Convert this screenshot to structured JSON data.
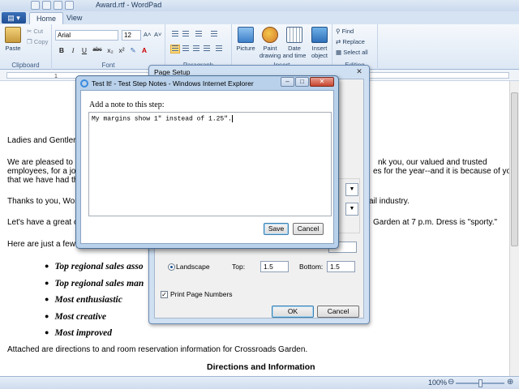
{
  "wordpad": {
    "title": "Award.rtf - WordPad",
    "app_button": "▤ ▾",
    "tabs": [
      "Home",
      "View"
    ],
    "ribbon": {
      "clipboard": {
        "label": "Clipboard",
        "paste": "Paste",
        "cut": "Cut",
        "copy": "Copy"
      },
      "font": {
        "label": "Font",
        "family": "Arial",
        "size": "12",
        "grow": "A˄",
        "shrink": "A˅",
        "bold": "B",
        "italic": "I",
        "underline": "U",
        "strike": "abc",
        "subscript": "x₂",
        "superscript": "x²"
      },
      "paragraph": {
        "label": "Paragraph"
      },
      "insert": {
        "label": "Insert",
        "picture": "Picture",
        "paint": "Paint drawing",
        "datetime": "Date and time",
        "object": "Insert object"
      },
      "editing": {
        "label": "Editing",
        "find": "Find",
        "replace": "Replace",
        "select_all": "Select all"
      }
    },
    "ruler": {
      "mark": "1"
    },
    "document": {
      "greeting": "Ladies and Gentler",
      "p1_l1_start": "We are pleased to",
      "p1_l1_end": "nk you, our valued and trusted",
      "p1_l2_start": "employees, for a job",
      "p1_l2_end": "es for the year--and it is because of you",
      "p1_l3": "that we have had thi",
      "p2_start": "Thanks to you, Worl",
      "p2_end": "ail industry.",
      "p3_start": "Let's have a great c",
      "p3_end": "Garden at 7 p.m. Dress is \"sporty.\"",
      "p4": "Here are just a few",
      "bullets": [
        "Top regional sales asso",
        "Top regional sales man",
        "Most enthusiastic",
        "Most creative",
        "Most improved"
      ],
      "attached": "Attached are directions to and room reservation information for Crossroads Garden.",
      "heading": "Directions and Information"
    },
    "status": {
      "zoom": "100%",
      "zoom_out": "⊖",
      "zoom_in": "⊕"
    }
  },
  "page_setup": {
    "title": "Page Setup",
    "close": "✕",
    "landscape": "Landscape",
    "top_label": "Top:",
    "top_value": "1.5",
    "bottom_label": "Bottom:",
    "bottom_value": "1.5",
    "print_page_numbers": "Print Page Numbers",
    "ok": "OK",
    "cancel": "Cancel"
  },
  "note_dialog": {
    "title": "Test It! - Test Step Notes - Windows Internet Explorer",
    "prompt": "Add a note to this step:",
    "note_text": "My margins show 1\" instead of 1.25\".",
    "save": "Save",
    "cancel": "Cancel",
    "min": "–",
    "max": "□",
    "close": "✕"
  }
}
